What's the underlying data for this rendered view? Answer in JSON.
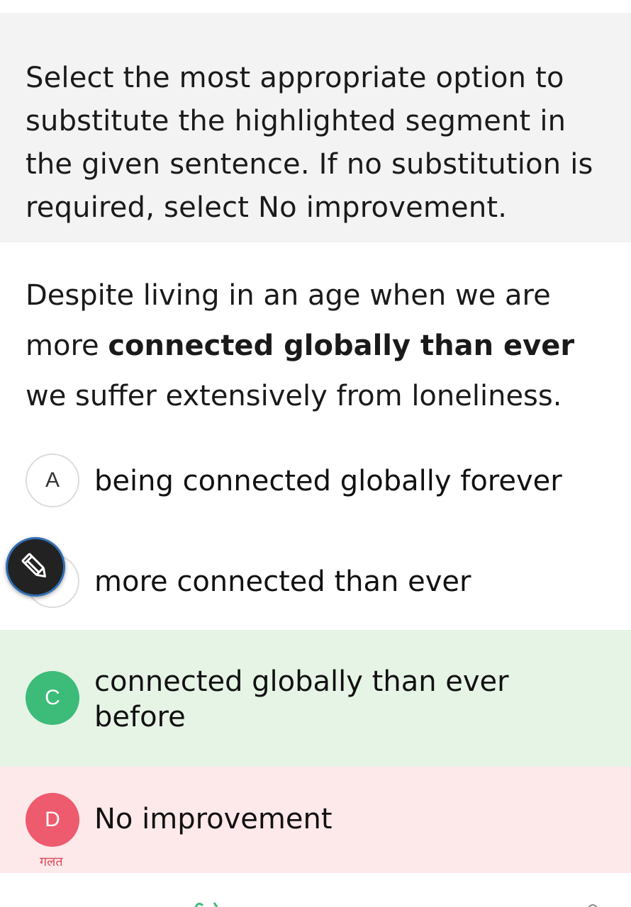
{
  "instruction": "Select the most appropriate option to substitute the highlighted segment in the given sentence. If no substitution is required, select No improvement.",
  "question": {
    "before": "Despite living in an age when we are more ",
    "highlight": "connected globally than ever",
    "after": " we suffer extensively from loneliness."
  },
  "options": [
    {
      "letter": "A",
      "text": "being connected globally forever",
      "state": "neutral"
    },
    {
      "letter": "B",
      "text": "more connected than ever",
      "state": "neutral"
    },
    {
      "letter": "C",
      "text": "connected globally than ever before",
      "state": "correct"
    },
    {
      "letter": "D",
      "text": "No improvement",
      "state": "wrong"
    }
  ],
  "wrong_label": "गलत",
  "colors": {
    "correct_bg": "#e6f4e6",
    "correct_circle": "#3dbb79",
    "wrong_bg": "#fde8ea",
    "wrong_circle": "#ee5b6e"
  },
  "icons": {
    "fab": "pencil-icon"
  }
}
